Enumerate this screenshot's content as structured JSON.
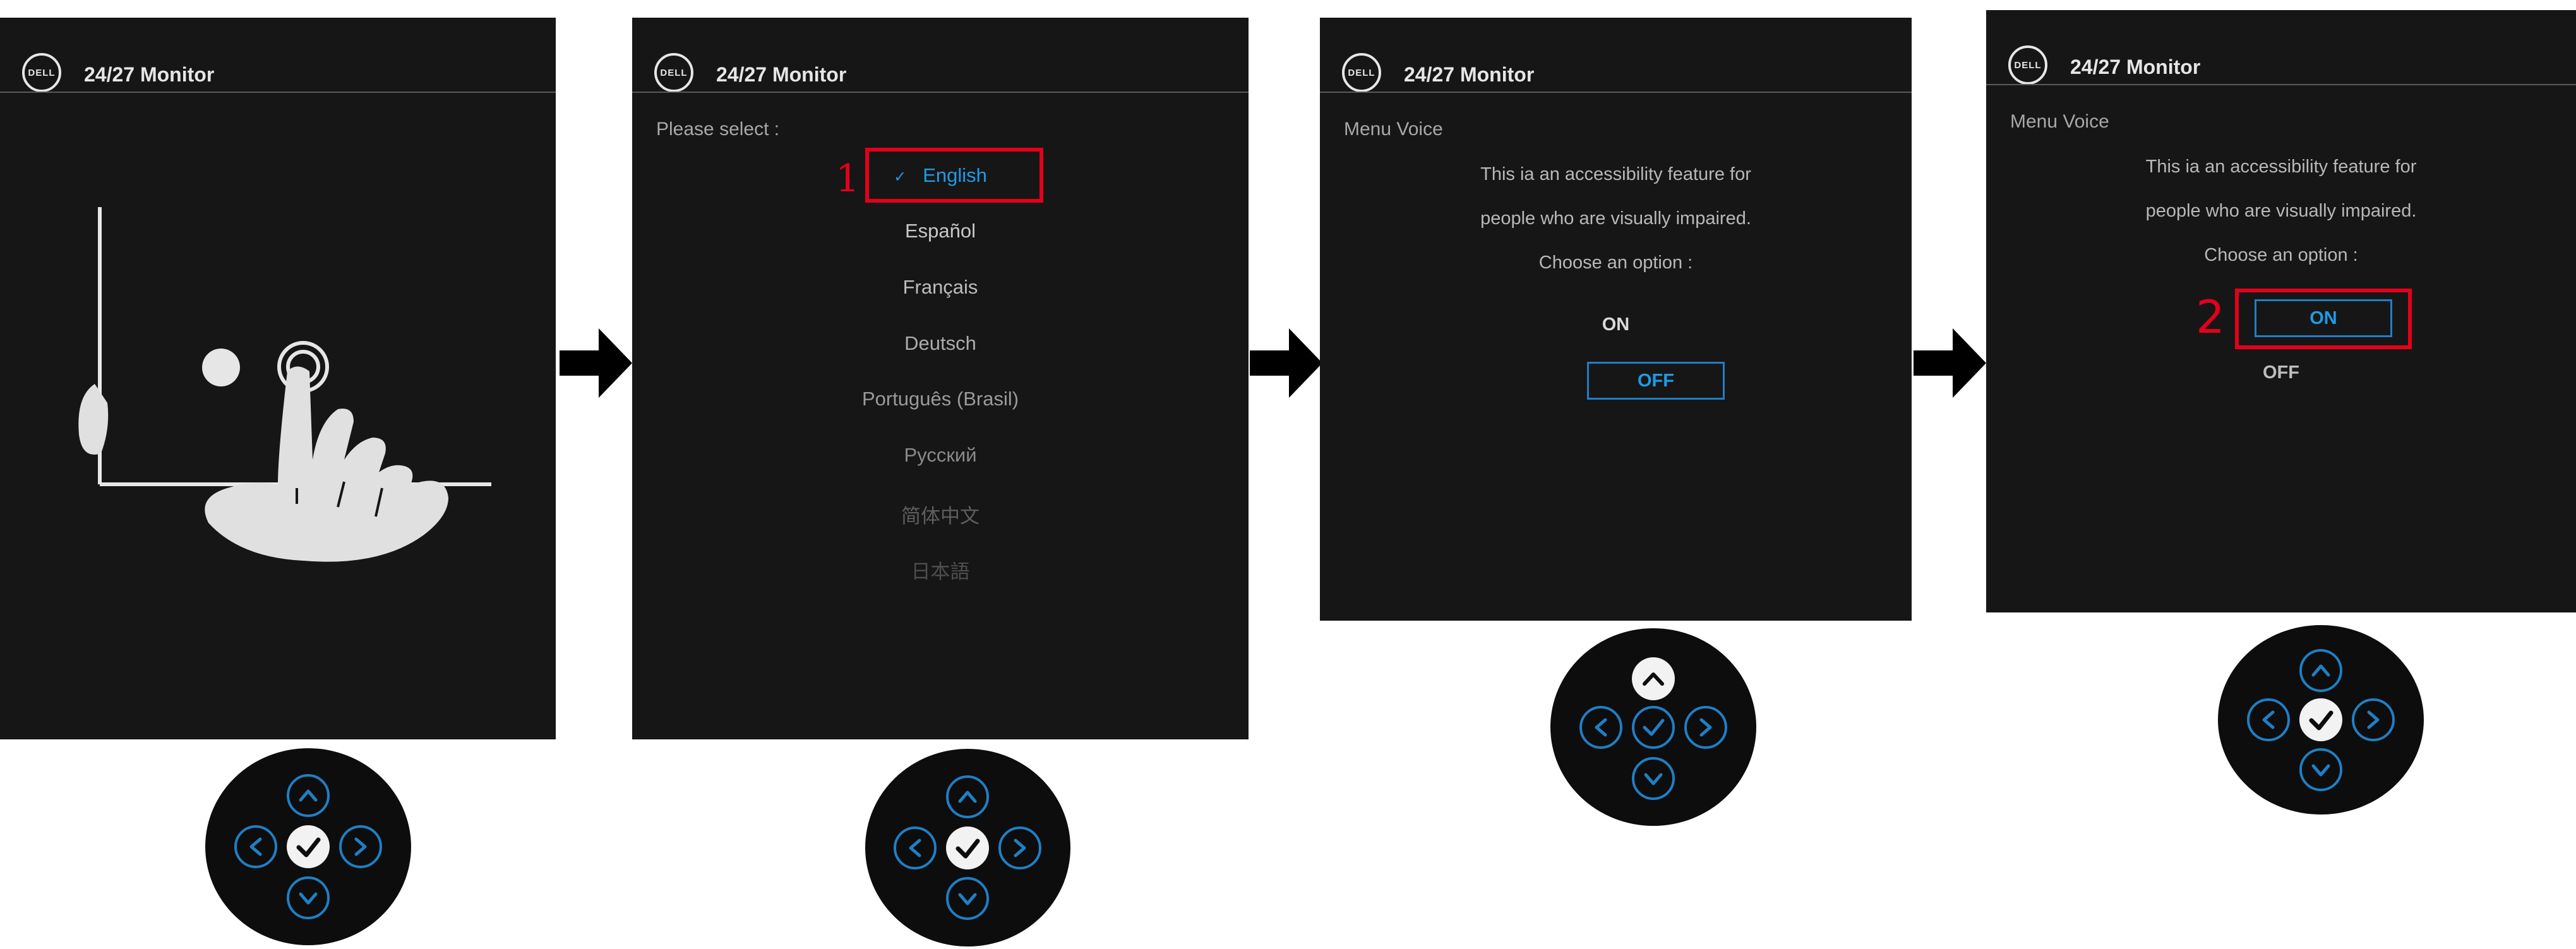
{
  "header": {
    "logo_text": "DELL",
    "title": "24/27 Monitor"
  },
  "step2": {
    "prompt": "Please select :",
    "languages": [
      "English",
      "Español",
      "Français",
      "Deutsch",
      "Português (Brasil)",
      "Русский",
      "简体中文",
      "日本語"
    ],
    "selected_mark": "✓",
    "step_number": "1"
  },
  "step3": {
    "menu_label": "Menu Voice",
    "line1": "This ia an accessibility feature for",
    "line2": "people who are visually impaired.",
    "line3": "Choose an option :",
    "on": "ON",
    "off": "OFF"
  },
  "step4": {
    "menu_label": "Menu Voice",
    "line1": "This ia an accessibility feature for",
    "line2": "people who are visually impaired.",
    "line3": "Choose an option :",
    "on": "ON",
    "off": "OFF",
    "step_number": "2"
  },
  "icons": {
    "flow_arrow": "right-arrow-icon",
    "joystick": "joystick-icon",
    "up": "chevron-up-icon",
    "down": "chevron-down-icon",
    "left": "chevron-left-icon",
    "right": "chevron-right-icon",
    "confirm": "check-icon"
  },
  "colors": {
    "screen_bg": "#161616",
    "accent_blue": "#1f7fc5",
    "highlight_red": "#e3001b",
    "text_light": "#d9d9d9"
  }
}
